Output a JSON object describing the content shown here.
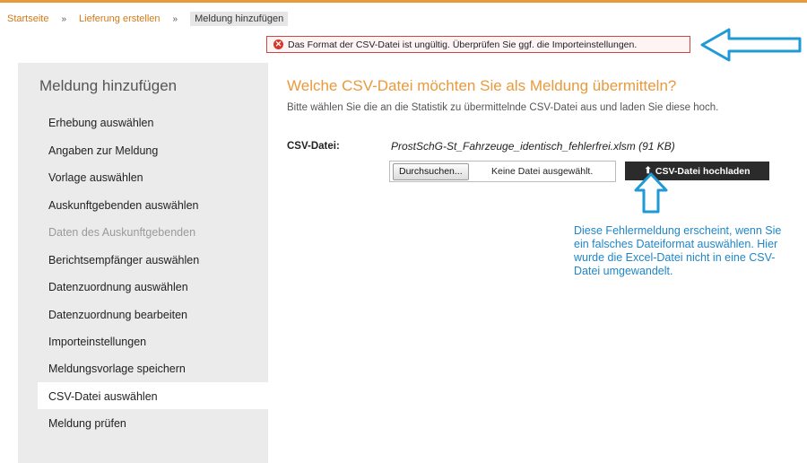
{
  "breadcrumb": {
    "items": [
      "Startseite",
      "Lieferung erstellen",
      "Meldung hinzufügen"
    ],
    "separator": "»"
  },
  "error": {
    "icon": "error-icon",
    "message": "Das Format der CSV-Datei ist ungültig. Überprüfen Sie ggf. die Importeinstellungen."
  },
  "sidebar": {
    "title": "Meldung hinzufügen",
    "items": [
      {
        "label": "Erhebung auswählen"
      },
      {
        "label": "Angaben zur Meldung"
      },
      {
        "label": "Vorlage auswählen"
      },
      {
        "label": "Auskunftgebenden auswählen"
      },
      {
        "label": "Daten des Auskunftgebenden"
      },
      {
        "label": "Berichtsempfänger auswählen"
      },
      {
        "label": "Datenzuordnung auswählen"
      },
      {
        "label": "Datenzuordnung bearbeiten"
      },
      {
        "label": "Importeinstellungen"
      },
      {
        "label": "Meldungsvorlage speichern"
      },
      {
        "label": "CSV-Datei auswählen"
      },
      {
        "label": "Meldung prüfen"
      }
    ],
    "active_item": "CSV-Datei auswählen",
    "disabled_item": "Daten des Auskunftgebenden"
  },
  "main": {
    "title": "Welche CSV-Datei möchten Sie als Meldung übermitteln?",
    "description": "Bitte wählen Sie die an die Statistik zu übermittelnde CSV-Datei aus und laden Sie diese hoch.",
    "csv_label": "CSV-Datei:",
    "file_name": "ProstSchG-St_Fahrzeuge_identisch_fehlerfrei.xlsm (91 KB)",
    "browse_label": "Durchsuchen...",
    "no_file_label": "Keine Datei ausgewählt.",
    "upload_label": "CSV-Datei hochladen",
    "upload_icon": "upload-icon"
  },
  "annotation": {
    "text": "Diese Fehlermeldung erscheint, wenn Sie ein falsches Dateiformat auswählen. Hier wurde die Excel-Datei nicht in eine CSV-Datei umgewandelt."
  },
  "colors": {
    "accent": "#e89a3c",
    "link": "#d07a1a",
    "error": "#d9362b",
    "annotation": "#1f86c7",
    "sidebar_bg": "#ebebeb"
  }
}
